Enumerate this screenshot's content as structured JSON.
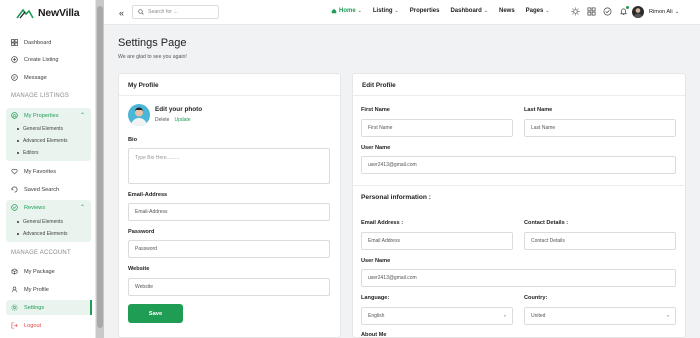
{
  "app": {
    "name": "NewVilla"
  },
  "sidebar": {
    "items": [
      {
        "label": "Dashboard",
        "icon": "dashboard-icon"
      },
      {
        "label": "Create Listing",
        "icon": "create-listing-icon"
      },
      {
        "label": "Message",
        "icon": "message-icon"
      }
    ],
    "section_listings": "MANAGE LISTINGS",
    "my_properties": {
      "label": "My Properties",
      "icon": "home-icon",
      "subitems": [
        "General Elements",
        "Advanced Elements",
        "Editors"
      ]
    },
    "my_favorites": "My Favorites",
    "saved_search": "Saved Search",
    "reviews": {
      "label": "Reviews",
      "icon": "review-icon",
      "subitems": [
        "General Elements",
        "Advanced Elements"
      ]
    },
    "section_account": "MANAGE ACCOUNT",
    "account_items": [
      {
        "label": "My Package",
        "icon": "package-icon"
      },
      {
        "label": "My Profile",
        "icon": "profile-icon"
      },
      {
        "label": "Settings",
        "icon": "settings-icon"
      },
      {
        "label": "Logout",
        "icon": "logout-icon"
      }
    ],
    "accent_color": "#1f9d55"
  },
  "topbar": {
    "collapse": "«",
    "search_placeholder": "Search for ...",
    "menu": [
      {
        "label": "Home",
        "dropdown": true
      },
      {
        "label": "Listing",
        "dropdown": true
      },
      {
        "label": "Properties",
        "dropdown": false
      },
      {
        "label": "Dashboard",
        "dropdown": true
      },
      {
        "label": "News",
        "dropdown": false
      },
      {
        "label": "Pages",
        "dropdown": true
      }
    ],
    "user_name": "Rimon Ali",
    "chevron": "⌄"
  },
  "main": {
    "title": "Settings Page",
    "subtitle": "We are glad to see you again!",
    "profile_card": {
      "heading": "My Profile",
      "photo_title": "Edit your photo",
      "delete": "Delete",
      "update": "Update",
      "bio_label": "Bio",
      "bio_placeholder": "Type Bio Here.........",
      "email_label": "Email-Address",
      "email_placeholder": "Email-Address",
      "password_label": "Password",
      "password_placeholder": "Password",
      "website_label": "Website",
      "website_placeholder": "Website",
      "save": "Save"
    },
    "edit_card": {
      "heading": "Edit Profile",
      "first_name_label": "First Name",
      "first_name_placeholder": "First Name",
      "last_name_label": "Last Name",
      "last_name_placeholder": "Last Name",
      "username_label": "User Name",
      "username_value": "user2413@gmail.com",
      "personal_title": "Personal information :",
      "email_label": "Email Address :",
      "email_placeholder": "Email Address",
      "contact_label": "Contact Details :",
      "contact_placeholder": "Contact Details",
      "username2_label": "User Name",
      "username2_value": "user2413@gmail.com",
      "language_label": "Language:",
      "language_value": "English",
      "country_label": "Country:",
      "country_value": "United",
      "about_label": "About Me"
    }
  }
}
